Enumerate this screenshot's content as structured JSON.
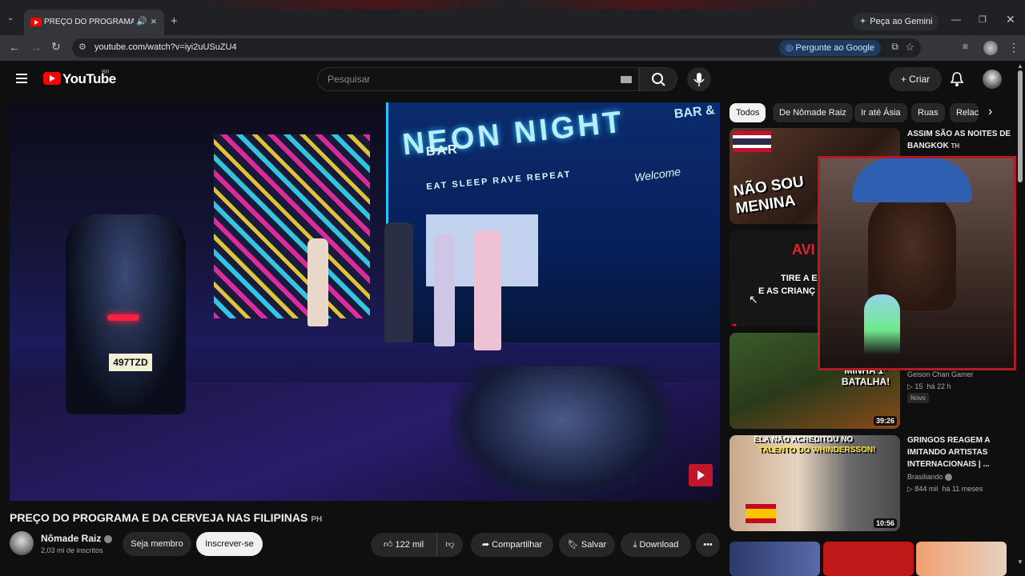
{
  "browser": {
    "tab_title": "PREÇO DO PROGRAMA E DA CERVEJA NAS FILIPINAS",
    "gemini_label": "Peça ao Gemini",
    "url": "youtube.com/watch?v=iyi2uUSuZU4",
    "ask_google_label": "Pergunte ao Google"
  },
  "header": {
    "logo_text": "YouTube",
    "logo_region": "BR",
    "search_placeholder": "Pesquisar",
    "create_label": "Criar"
  },
  "video": {
    "sign_title": "NEON NIGHT",
    "sign_bar": "BAR &",
    "sign_sub": "EAT  SLEEP  RAVE  REPEAT",
    "sign_welcome": "Welcome",
    "plate_text": "497TZD",
    "title": "PREÇO DO PROGRAMA E DA CERVEJA NAS FILIPINAS",
    "title_flag": "PH"
  },
  "channel": {
    "name": "Nômade Raiz",
    "subscribers": "2,03 mi de inscritos",
    "member_label": "Seja membro",
    "subscribe_label": "Inscrever-se"
  },
  "actions": {
    "likes": "122 mil",
    "share_label": "Compartilhar",
    "save_label": "Salvar",
    "download_label": "Download"
  },
  "chips": [
    "Todos",
    "De Nômade Raiz",
    "Ir até Ásia",
    "Ruas",
    "Relac"
  ],
  "recommendations": [
    {
      "title": "ASSIM SÃO AS NOITES DE BANGKOK",
      "title_flag": "TH",
      "thumb_text": "NÃO SOU MENINA"
    },
    {
      "thumb_text_1": "AVI",
      "thumb_text_2": "TIRE A E",
      "thumb_text_3": "E AS CRIANÇ"
    },
    {
      "channel": "Geison Chan Gamer",
      "views": "15",
      "age": "há 22 h",
      "badge": "Novo",
      "duration": "39:26",
      "thumb_text": "MINHA 1ª BATALHA!"
    },
    {
      "title": "GRINGOS REAGEM A IMITANDO ARTISTAS INTERNACIONAIS | ...",
      "channel": "Brasiliando",
      "views": "844 mil",
      "age": "há 11 meses",
      "duration": "10:56",
      "thumb_text_1": "ELA NÃO ACREDITOU NO",
      "thumb_text_2": "TALENTO DO WHINDERSSON!"
    }
  ],
  "colors": {
    "youtube_red": "#ff0000",
    "background": "#0f0f0f",
    "webcam_border": "#b01b25"
  }
}
